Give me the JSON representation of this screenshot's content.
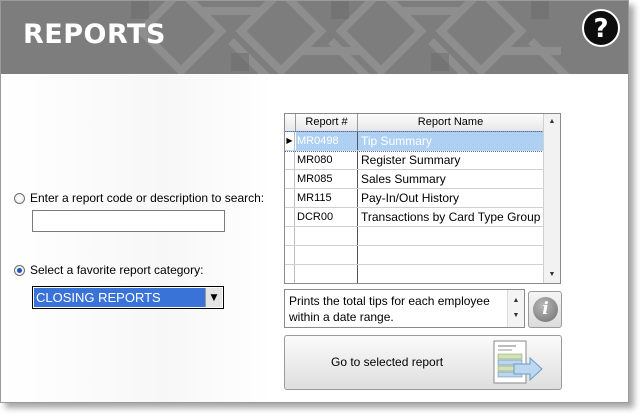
{
  "header": {
    "title": "REPORTS",
    "help_label": "?"
  },
  "search": {
    "radio_label": "Enter a report code or description to search:",
    "input_value": "",
    "selected": false
  },
  "category": {
    "radio_label": "Select a favorite report category:",
    "selected_value": "CLOSING REPORTS",
    "selected": true
  },
  "report_table": {
    "columns": [
      "Report #",
      "Report Name"
    ],
    "rows": [
      {
        "code": "MR0498",
        "name": "Tip Summary",
        "selected": true
      },
      {
        "code": "MR080",
        "name": "Register Summary",
        "selected": false
      },
      {
        "code": "MR085",
        "name": "Sales Summary",
        "selected": false
      },
      {
        "code": "MR115",
        "name": "Pay-In/Out History",
        "selected": false
      },
      {
        "code": "DCR00",
        "name": "Transactions by Card Type Group",
        "selected": false
      }
    ],
    "row_indicator": "▶"
  },
  "description": {
    "text": "Prints the total tips for each employee within a date range."
  },
  "info_button": {
    "label": "i"
  },
  "go_button": {
    "label": "Go to selected report"
  },
  "colors": {
    "header_bg": "#7d7d7d",
    "selection_bg": "#aed0f3",
    "dropdown_bg": "#3a73d8"
  },
  "icons": [
    "help-icon",
    "info-icon",
    "report-document-arrow-icon",
    "row-indicator-icon"
  ]
}
